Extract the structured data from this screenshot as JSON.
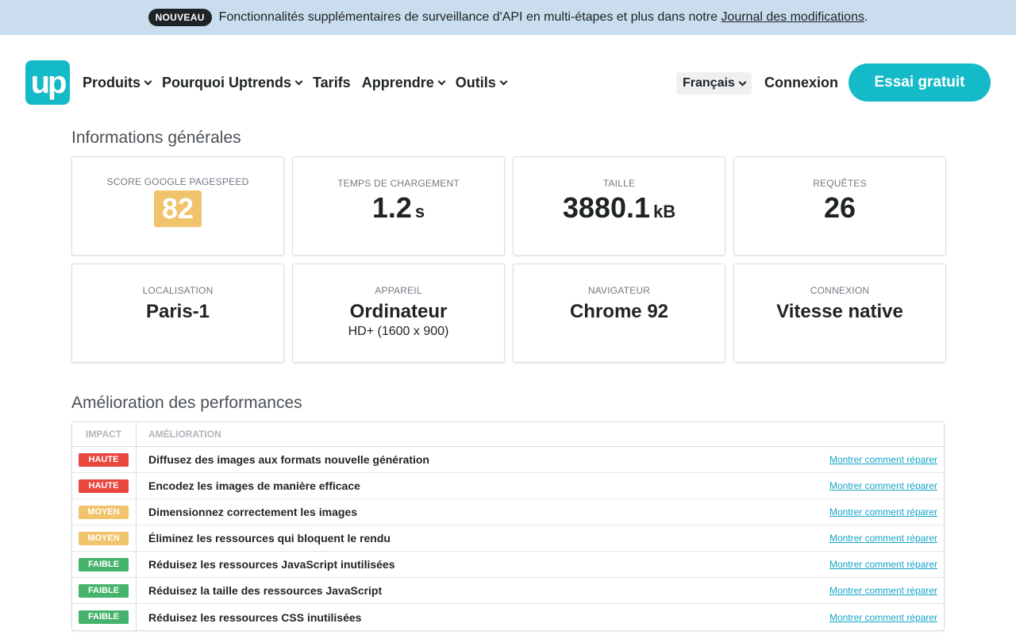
{
  "banner": {
    "badge": "NOUVEAU",
    "text": "Fonctionnalités supplémentaires de surveillance d'API en multi-étapes et plus dans notre ",
    "link": "Journal des modifications",
    "suffix": "."
  },
  "nav": {
    "logo": "up",
    "items": [
      {
        "label": "Produits",
        "dropdown": true
      },
      {
        "label": "Pourquoi Uptrends",
        "dropdown": true
      },
      {
        "label": "Tarifs",
        "dropdown": false
      },
      {
        "label": "Apprendre",
        "dropdown": true
      },
      {
        "label": "Outils",
        "dropdown": true
      }
    ],
    "language": "Français",
    "login": "Connexion",
    "cta": "Essai gratuit"
  },
  "general": {
    "title": "Informations générales",
    "score": {
      "label": "SCORE GOOGLE PAGESPEED",
      "value": "82"
    },
    "load": {
      "label": "TEMPS DE CHARGEMENT",
      "value": "1.2",
      "unit": "s"
    },
    "size": {
      "label": "TAILLE",
      "value": "3880.1",
      "unit": "kB"
    },
    "requests": {
      "label": "REQUÊTES",
      "value": "26"
    },
    "location": {
      "label": "LOCALISATION",
      "value": "Paris-1"
    },
    "device": {
      "label": "APPAREIL",
      "value": "Ordinateur",
      "sub": "HD+ (1600 x 900)"
    },
    "browser": {
      "label": "NAVIGATEUR",
      "value": "Chrome 92"
    },
    "connection": {
      "label": "CONNEXION",
      "value": "Vitesse native"
    }
  },
  "performance": {
    "title": "Amélioration des performances",
    "headers": {
      "impact": "IMPACT",
      "improvement": "AMÉLIORATION"
    },
    "link_label": "Montrer comment réparer",
    "rows": [
      {
        "impact": "HAUTE",
        "color": "#e8473f",
        "text": "Diffusez des images aux formats nouvelle génération"
      },
      {
        "impact": "HAUTE",
        "color": "#e8473f",
        "text": "Encodez les images de manière efficace"
      },
      {
        "impact": "MOYEN",
        "color": "#f0c36d",
        "text": "Dimensionnez correctement les images"
      },
      {
        "impact": "MOYEN",
        "color": "#f0c36d",
        "text": "Éliminez les ressources qui bloquent le rendu"
      },
      {
        "impact": "FAIBLE",
        "color": "#45b36b",
        "text": "Réduisez les ressources JavaScript inutilisées"
      },
      {
        "impact": "FAIBLE",
        "color": "#45b36b",
        "text": "Réduisez la taille des ressources JavaScript"
      },
      {
        "impact": "FAIBLE",
        "color": "#45b36b",
        "text": "Réduisez les ressources CSS inutilisées"
      }
    ]
  }
}
